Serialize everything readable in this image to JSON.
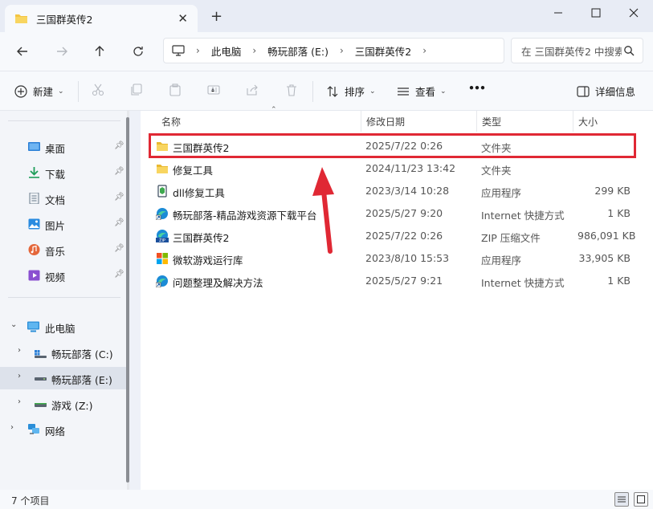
{
  "window": {
    "tab_title": "三国群英传2",
    "new_tab": "+",
    "close_tab": "✕",
    "minimize": "—",
    "maximize": "☐",
    "close": "✕"
  },
  "nav": {
    "breadcrumbs": [
      "此电脑",
      "畅玩部落 (E:)",
      "三国群英传2"
    ],
    "search_placeholder": "在 三国群英传2 中搜索"
  },
  "commands": {
    "new_label": "新建",
    "sort_label": "排序",
    "view_label": "查看",
    "more_label": "•••",
    "details_label": "详细信息"
  },
  "sidebar": {
    "quick": [
      {
        "label": "桌面",
        "icon": "desktop-icon",
        "color": "#2b7fd6"
      },
      {
        "label": "下载",
        "icon": "download-icon",
        "color": "#1f9e5a"
      },
      {
        "label": "文档",
        "icon": "document-icon",
        "color": "#6a7a8c"
      },
      {
        "label": "图片",
        "icon": "picture-icon",
        "color": "#2a8be0"
      },
      {
        "label": "音乐",
        "icon": "music-icon",
        "color": "#e4663a"
      },
      {
        "label": "视频",
        "icon": "video-icon",
        "color": "#8a4fd0"
      }
    ],
    "this_pc": "此电脑",
    "drives": [
      {
        "label": "畅玩部落 (C:)",
        "icon": "windows-drive-icon"
      },
      {
        "label": "畅玩部落 (E:)",
        "icon": "drive-icon"
      },
      {
        "label": "游戏 (Z:)",
        "icon": "drive-icon"
      }
    ],
    "network": "网络"
  },
  "columns": {
    "name": "名称",
    "date": "修改日期",
    "type": "类型",
    "size": "大小"
  },
  "files": [
    {
      "name": "三国群英传2",
      "date": "2025/7/22 0:26",
      "type": "文件夹",
      "size": "",
      "icon": "folder-icon"
    },
    {
      "name": "修复工具",
      "date": "2024/11/23 13:42",
      "type": "文件夹",
      "size": "",
      "icon": "folder-icon"
    },
    {
      "name": "dll修复工具",
      "date": "2023/3/14 10:28",
      "type": "应用程序",
      "size": "299 KB",
      "icon": "app-icon"
    },
    {
      "name": "畅玩部落-精品游戏资源下载平台",
      "date": "2025/5/27 9:20",
      "type": "Internet 快捷方式",
      "size": "1 KB",
      "icon": "internet-shortcut-icon"
    },
    {
      "name": "三国群英传2",
      "date": "2025/7/22 0:26",
      "type": "ZIP 压缩文件",
      "size": "986,091 KB",
      "icon": "zip-icon"
    },
    {
      "name": "微软游戏运行库",
      "date": "2023/8/10 15:53",
      "type": "应用程序",
      "size": "33,905 KB",
      "icon": "windows-app-icon"
    },
    {
      "name": "问题整理及解决方法",
      "date": "2025/5/27 9:21",
      "type": "Internet 快捷方式",
      "size": "1 KB",
      "icon": "internet-shortcut-icon"
    }
  ],
  "status": {
    "item_count": "7 个项目"
  },
  "colors": {
    "accent": "#0067c0",
    "highlight": "#e02834",
    "folder": "#f4c542"
  }
}
